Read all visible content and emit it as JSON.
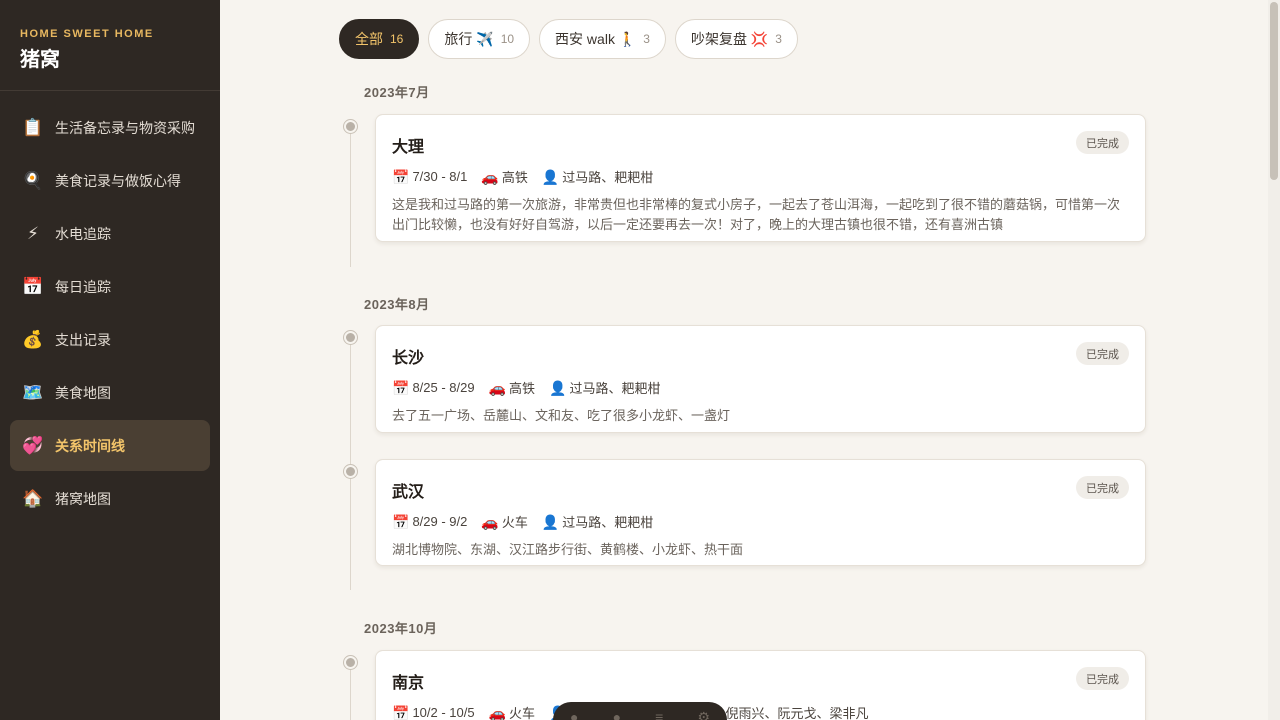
{
  "brand": {
    "subtitle": "HOME SWEET HOME",
    "title": "猪窝"
  },
  "sidebar": {
    "items": [
      {
        "icon": "📋",
        "label": "生活备忘录与物资采购"
      },
      {
        "icon": "🍳",
        "label": "美食记录与做饭心得"
      },
      {
        "icon": "⚡",
        "label": "水电追踪"
      },
      {
        "icon": "📅",
        "label": "每日追踪"
      },
      {
        "icon": "💰",
        "label": "支出记录"
      },
      {
        "icon": "🗺️",
        "label": "美食地图"
      },
      {
        "icon": "💞",
        "label": "关系时间线",
        "active": true
      },
      {
        "icon": "🏠",
        "label": "猪窝地图"
      }
    ]
  },
  "filters": [
    {
      "label": "全部",
      "count": "16",
      "active": true
    },
    {
      "label": "旅行 ✈️",
      "count": "10"
    },
    {
      "label": "西安 walk 🚶",
      "count": "3"
    },
    {
      "label": "吵架复盘 💢",
      "count": "3"
    }
  ],
  "months": [
    "2023年7月",
    "2023年8月",
    "2023年10月"
  ],
  "cards": [
    {
      "title": "大理",
      "status": "已完成",
      "date": "7/30 - 8/1",
      "transport": "高铁",
      "people": "过马路、耙耙柑",
      "desc": "这是我和过马路的第一次旅游，非常贵但也非常棒的复式小房子，一起去了苍山洱海，一起吃到了很不错的蘑菇锅，可惜第一次出门比较懒，也没有好好自驾游，以后一定还要再去一次！对了，晚上的大理古镇也很不错，还有喜洲古镇"
    },
    {
      "title": "长沙",
      "status": "已完成",
      "date": "8/25 - 8/29",
      "transport": "高铁",
      "people": "过马路、耙耙柑",
      "desc": "去了五一广场、岳麓山、文和友、吃了很多小龙虾、一盏灯"
    },
    {
      "title": "武汉",
      "status": "已完成",
      "date": "8/29 - 9/2",
      "transport": "火车",
      "people": "过马路、耙耙柑",
      "desc": "湖北博物院、东湖、汉江路步行街、黄鹤楼、小龙虾、热干面"
    },
    {
      "title": "南京",
      "status": "已完成",
      "date": "10/2 - 10/5",
      "transport": "火车",
      "people": "过马路、耙耙柑、黄宇晗、倪雨兴、阮元戈、梁非凡",
      "desc": ""
    }
  ],
  "icons": {
    "calendar": "📅",
    "transport": "🚗",
    "people": "👤"
  },
  "colors": {
    "sidebar_bg": "#2e2823",
    "accent": "#f2c46a",
    "page_bg": "#f7f4ef"
  }
}
